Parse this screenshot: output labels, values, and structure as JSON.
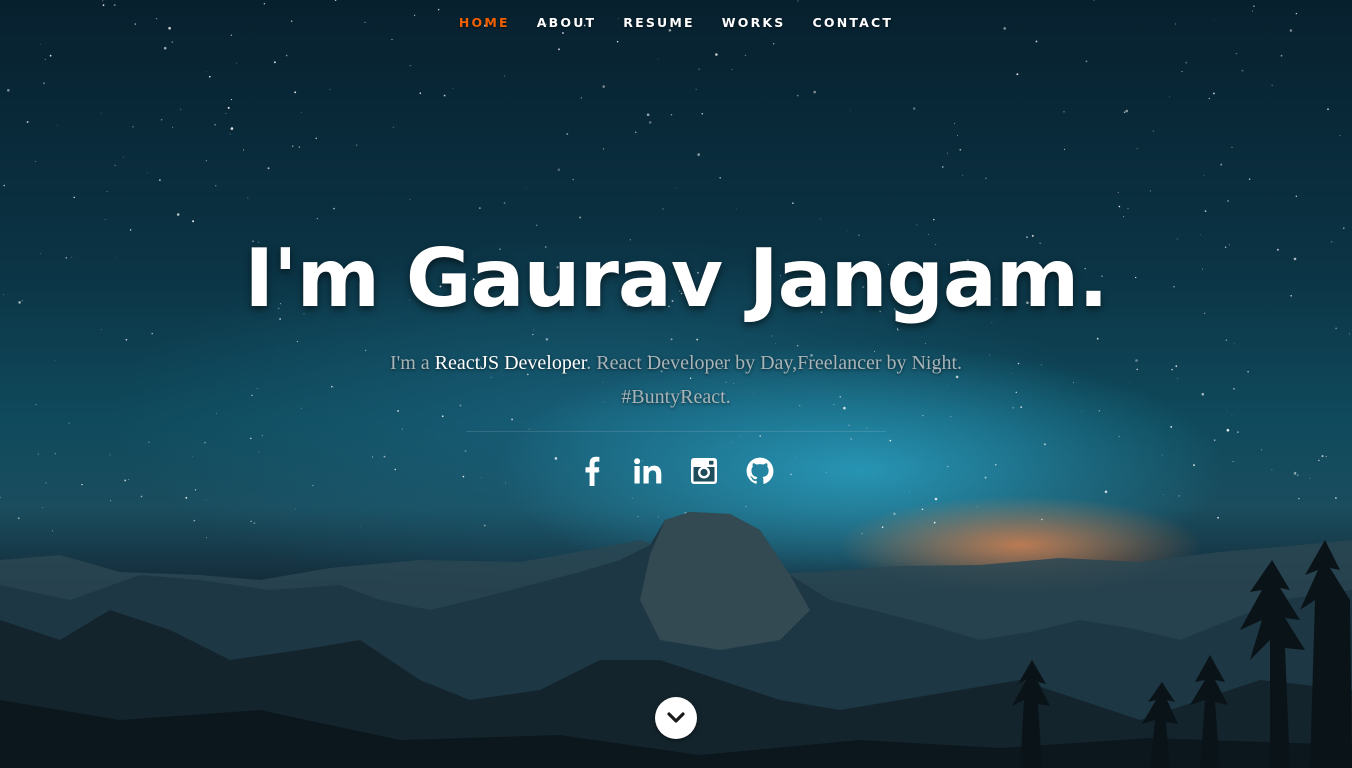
{
  "nav": {
    "items": [
      {
        "label": "HOME",
        "active": true
      },
      {
        "label": "ABOUT",
        "active": false
      },
      {
        "label": "RESUME",
        "active": false
      },
      {
        "label": "WORKS",
        "active": false
      },
      {
        "label": "CONTACT",
        "active": false
      }
    ],
    "active_color": "#f06000"
  },
  "hero": {
    "headline": "I'm Gaurav Jangam.",
    "tagline_prefix": "I'm a ",
    "tagline_role": "ReactJS Developer",
    "tagline_rest": ". React Developer by Day,Freelancer by Night.",
    "tagline_hashtag": "#BuntyReact."
  },
  "social": [
    {
      "icon": "facebook-icon"
    },
    {
      "icon": "linkedin-icon"
    },
    {
      "icon": "instagram-icon"
    },
    {
      "icon": "github-icon"
    }
  ],
  "scroll_button": {
    "icon": "chevron-down-icon"
  }
}
